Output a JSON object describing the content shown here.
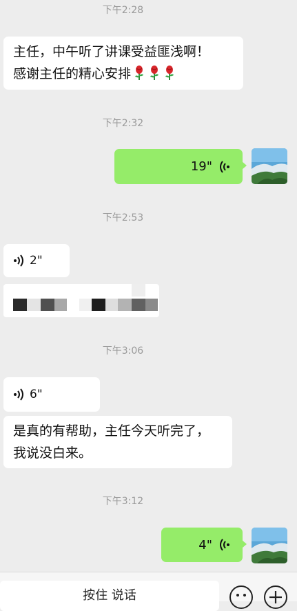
{
  "messages": {
    "time1": "下午2:28",
    "msg1_line1": "主任，中午听了讲课受益匪浅啊！",
    "msg1_line2": "感谢主任的精心安排",
    "time2": "下午2:32",
    "voice_out1": "19\"",
    "time3": "下午2:53",
    "voice_in1": "2\"",
    "time4": "下午3:06",
    "voice_in2": "6\"",
    "msg2_line1": "是真的有帮助，主任今天听完了，",
    "msg2_line2": "我说没白来。",
    "time5": "下午3:12",
    "voice_out2": "4\""
  },
  "input_bar": {
    "hold_to_talk": "按住 说话"
  },
  "icons": {
    "flower": "rose-icon",
    "voice": "voice-wave-icon",
    "emoji": "emoji-icon",
    "plus": "plus-icon"
  },
  "colors": {
    "background": "#ededed",
    "outgoing_bubble": "#95ec69",
    "incoming_bubble": "#ffffff",
    "timestamp": "#9a9a9a"
  }
}
